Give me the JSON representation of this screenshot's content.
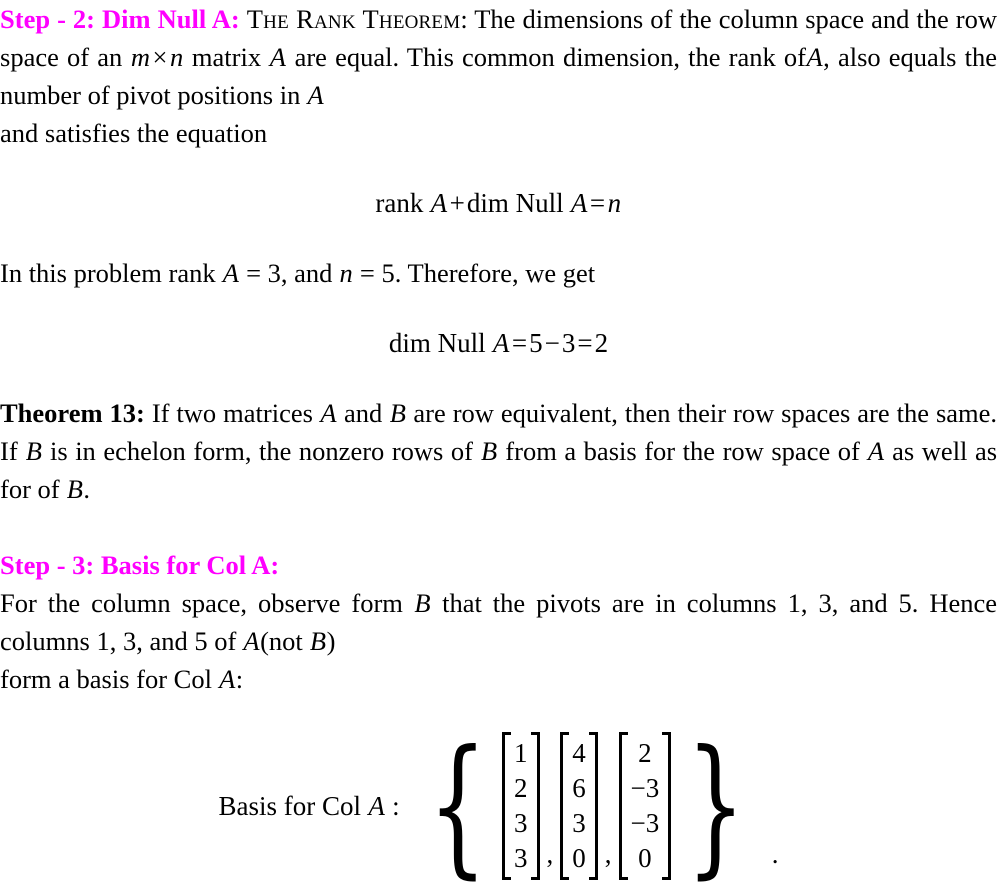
{
  "document": {
    "type": "linear-algebra-solution",
    "text_color": "#000000",
    "heading_color": "#ff00ff",
    "background_color": "#ffffff"
  },
  "step2": {
    "heading": "Step - 2:  Dim Null A:",
    "theorem_name": "The Rank Theorem",
    "theorem_name_colon": ":",
    "body_line1": "The dimensions of the",
    "body_part1": "column space and the row space of an",
    "var_m": "m",
    "times_symbol": "×",
    "var_n": "n",
    "body_part2": "matrix",
    "var_A_1": "A",
    "body_part3": "are equal.  This common dimension, the rank of",
    "var_A_2": "A",
    "body_part4": ", also equals the number of pivot positions in",
    "var_A_3": "A",
    "body_part5": "and satisfies the equation"
  },
  "equation1": {
    "rank_word": "rank",
    "var_A": "A",
    "plus": "+",
    "dim_word": "dim",
    "null_word": "Null",
    "var_A2": "A",
    "equals": "=",
    "var_n": "n",
    "full_text": "rank A + dim Null A = n"
  },
  "between_equations": {
    "part1": "In this problem rank",
    "var_A": "A",
    "eq1": "= 3",
    "part2": ", and",
    "var_n": "n",
    "eq2": "= 5",
    "part3": ". Therefore, we get"
  },
  "equation2": {
    "dim_word": "dim",
    "null_word": "Null",
    "var_A": "A",
    "equals1": "=",
    "val1": "5",
    "minus": "−",
    "val2": "3",
    "equals2": "=",
    "result": "2",
    "full_text": "dim Null A = 5 − 3 = 2"
  },
  "theorem13": {
    "label": "Theorem 13:",
    "part1": "If two matrices",
    "var_A_1": "A",
    "part2": "and",
    "var_B_1": "B",
    "part3": "are row equivalent, then their row spaces are the same. If",
    "var_B_2": "B",
    "part4": "is in echelon form, the nonzero rows of",
    "var_B_3": "B",
    "part5": "from a basis for the row space of",
    "var_A_2": "A",
    "part6": "as well as for of",
    "var_B_4": "B",
    "part7": "."
  },
  "step3": {
    "heading": "Step - 3:  Basis for Col A:",
    "part1": "For the column space, observe form",
    "var_B_1": "B",
    "part2": "that the pivots are in columns",
    "cols_1": "1, 3,",
    "part3": "and 5. Hence columns",
    "cols_2": "1, 3,",
    "part4": "and 5 of",
    "var_A_1": "A",
    "paren_open": "(not",
    "var_B_2": "B",
    "paren_close": ")",
    "part5": "form a basis for Col",
    "var_A_2": "A",
    "colon": ":"
  },
  "basis": {
    "label_text": "Basis for Col",
    "label_var": "A",
    "label_colon": ":",
    "brace_open": "{",
    "brace_close": "}",
    "separator": ",",
    "terminator": ".",
    "vectors": [
      {
        "name": "column-1",
        "entries": [
          "1",
          "2",
          "3",
          "3"
        ]
      },
      {
        "name": "column-3",
        "entries": [
          "4",
          "6",
          "3",
          "0"
        ]
      },
      {
        "name": "column-5",
        "entries": [
          "2",
          "−3",
          "−3",
          "0"
        ]
      }
    ]
  }
}
